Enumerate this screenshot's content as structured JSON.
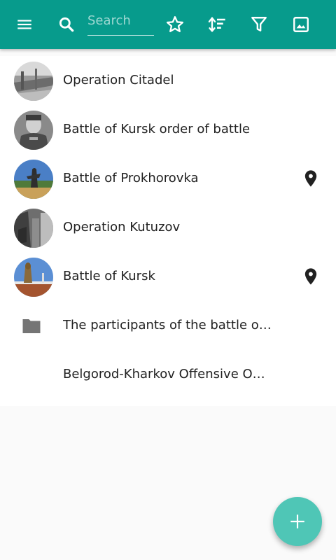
{
  "colors": {
    "toolbar": "#079b8c",
    "fab": "#4fc6b6",
    "pin": "#212121",
    "folder": "#757575"
  },
  "toolbar": {
    "menu_icon": "menu-icon",
    "search_icon": "search-icon",
    "search_placeholder": "Search",
    "favorites_icon": "star-outline-icon",
    "sort_icon": "sort-icon",
    "filter_icon": "filter-icon",
    "image_icon": "image-icon"
  },
  "list": {
    "items": [
      {
        "label": "Operation Citadel",
        "thumbnail": true,
        "pin": false
      },
      {
        "label": "Battle of Kursk order of battle",
        "thumbnail": true,
        "pin": false
      },
      {
        "label": "Battle of Prokhorovka",
        "thumbnail": true,
        "pin": true
      },
      {
        "label": "Operation Kutuzov",
        "thumbnail": true,
        "pin": false
      },
      {
        "label": "Battle of Kursk",
        "thumbnail": true,
        "pin": true
      },
      {
        "label": "The participants of the battle of Kursk",
        "folder": true
      },
      {
        "label": "Belgorod-Kharkov Offensive Operation"
      }
    ]
  },
  "fab": {
    "icon": "plus-icon"
  }
}
